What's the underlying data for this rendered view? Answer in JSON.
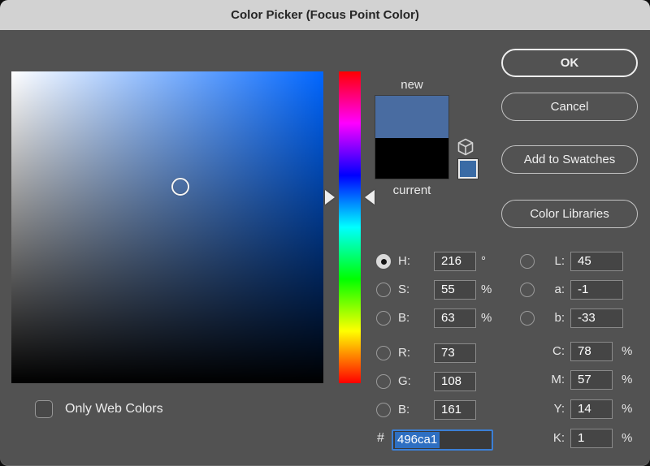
{
  "window": {
    "title": "Color Picker (Focus Point Color)"
  },
  "buttons": {
    "ok": "OK",
    "cancel": "Cancel",
    "add_to_swatches": "Add to Swatches",
    "color_libraries": "Color Libraries"
  },
  "swatches": {
    "new_label": "new",
    "current_label": "current",
    "new_color": "#496ca1",
    "current_color": "#000000",
    "websafe_color": "#3a6ba5"
  },
  "picker": {
    "hue_degrees": 216
  },
  "fields": {
    "left": [
      {
        "label": "H:",
        "value": "216",
        "unit": "°",
        "selected": true
      },
      {
        "label": "S:",
        "value": "55",
        "unit": "%",
        "selected": false
      },
      {
        "label": "B:",
        "value": "63",
        "unit": "%",
        "selected": false
      },
      {
        "label": "R:",
        "value": "73",
        "unit": "",
        "selected": false
      },
      {
        "label": "G:",
        "value": "108",
        "unit": "",
        "selected": false
      },
      {
        "label": "B:",
        "value": "161",
        "unit": "",
        "selected": false
      }
    ],
    "right": [
      {
        "label": "L:",
        "value": "45",
        "unit": ""
      },
      {
        "label": "a:",
        "value": "-1",
        "unit": ""
      },
      {
        "label": "b:",
        "value": "-33",
        "unit": ""
      },
      {
        "label": "C:",
        "value": "78",
        "unit": "%"
      },
      {
        "label": "M:",
        "value": "57",
        "unit": "%"
      },
      {
        "label": "Y:",
        "value": "14",
        "unit": "%"
      },
      {
        "label": "K:",
        "value": "1",
        "unit": "%"
      }
    ],
    "hex": {
      "prefix": "#",
      "value": "496ca1"
    }
  },
  "checkbox": {
    "label": "Only Web Colors",
    "checked": false
  },
  "colors": {
    "dialog_bg": "#525252",
    "titlebar_bg": "#d2d2d2",
    "field_pure_hue": "#0066ff",
    "hex_focus_border": "#3b7fd6",
    "hex_selection": "#2e6fc2"
  }
}
